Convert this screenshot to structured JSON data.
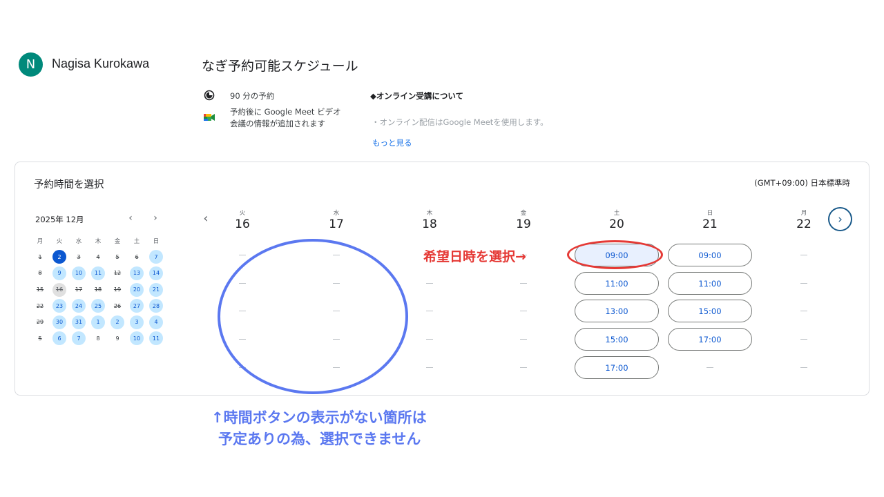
{
  "owner": {
    "initial": "N",
    "name": "Nagisa Kurokawa"
  },
  "page_title": "なぎ予約可能スケジュール",
  "info": {
    "duration": "90 分の予約",
    "meet_line1": "予約後に Google Meet ビデオ",
    "meet_line2": "会議の情報が追加されます",
    "online_heading": "◆オンライン受講について",
    "online_body": "・オンライン配信はGoogle Meetを使用します。",
    "more_link": "もっと見る"
  },
  "panel": {
    "title": "予約時間を選択",
    "timezone": "(GMT+09:00) 日本標準時"
  },
  "mini_calendar": {
    "month_label": "2025年 12月",
    "prev_icon": "chevron-left-icon",
    "next_icon": "chevron-right-icon",
    "weekdays": [
      "月",
      "火",
      "水",
      "木",
      "金",
      "土",
      "日"
    ],
    "weeks": [
      [
        {
          "d": "1",
          "s": "past"
        },
        {
          "d": "2",
          "s": "sel"
        },
        {
          "d": "3",
          "s": "past"
        },
        {
          "d": "4",
          "s": "past"
        },
        {
          "d": "5",
          "s": "past"
        },
        {
          "d": "6",
          "s": "past"
        },
        {
          "d": "7",
          "s": "avail"
        }
      ],
      [
        {
          "d": "8",
          "s": "past"
        },
        {
          "d": "9",
          "s": "avail"
        },
        {
          "d": "10",
          "s": "avail"
        },
        {
          "d": "11",
          "s": "avail"
        },
        {
          "d": "12",
          "s": "past"
        },
        {
          "d": "13",
          "s": "avail"
        },
        {
          "d": "14",
          "s": "avail"
        }
      ],
      [
        {
          "d": "15",
          "s": "past"
        },
        {
          "d": "16",
          "s": "today"
        },
        {
          "d": "17",
          "s": "past"
        },
        {
          "d": "18",
          "s": "past"
        },
        {
          "d": "19",
          "s": "past"
        },
        {
          "d": "20",
          "s": "avail"
        },
        {
          "d": "21",
          "s": "avail"
        }
      ],
      [
        {
          "d": "22",
          "s": "past"
        },
        {
          "d": "23",
          "s": "avail"
        },
        {
          "d": "24",
          "s": "avail"
        },
        {
          "d": "25",
          "s": "avail"
        },
        {
          "d": "26",
          "s": "past"
        },
        {
          "d": "27",
          "s": "avail"
        },
        {
          "d": "28",
          "s": "avail"
        }
      ],
      [
        {
          "d": "29",
          "s": "past"
        },
        {
          "d": "30",
          "s": "avail"
        },
        {
          "d": "31",
          "s": "avail"
        },
        {
          "d": "1",
          "s": "avail"
        },
        {
          "d": "2",
          "s": "avail"
        },
        {
          "d": "3",
          "s": "avail"
        },
        {
          "d": "4",
          "s": "avail"
        }
      ],
      [
        {
          "d": "5",
          "s": "past"
        },
        {
          "d": "6",
          "s": "avail"
        },
        {
          "d": "7",
          "s": "avail"
        },
        {
          "d": "8",
          "s": "none"
        },
        {
          "d": "9",
          "s": "none"
        },
        {
          "d": "10",
          "s": "avail"
        },
        {
          "d": "11",
          "s": "avail"
        }
      ]
    ]
  },
  "week": {
    "prev_icon": "chevron-left-icon",
    "next_icon": "chevron-right-icon",
    "days": [
      {
        "dow": "火",
        "num": "16",
        "slots": [],
        "dashes": 5
      },
      {
        "dow": "水",
        "num": "17",
        "slots": [],
        "dashes": 5
      },
      {
        "dow": "木",
        "num": "18",
        "slots": [],
        "dashes": 5
      },
      {
        "dow": "金",
        "num": "19",
        "slots": [],
        "dashes": 5
      },
      {
        "dow": "土",
        "num": "20",
        "slots": [
          "09:00",
          "11:00",
          "13:00",
          "15:00",
          "17:00"
        ],
        "dashes": 0
      },
      {
        "dow": "日",
        "num": "21",
        "slots": [
          "09:00",
          "11:00",
          "15:00",
          "17:00"
        ],
        "dashes": 1
      },
      {
        "dow": "月",
        "num": "22",
        "slots": [],
        "dashes": 5
      }
    ]
  },
  "annotations": {
    "red_label": "希望日時を選択→",
    "blue_note_line1": "↑時間ボタンの表示がない箇所は",
    "blue_note_line2": "予定ありの為、選択できません"
  },
  "colors": {
    "accent": "#0b57d0",
    "available_bg": "#c2e7ff",
    "annotation_red": "#e53935",
    "annotation_blue": "#5b78f0"
  }
}
